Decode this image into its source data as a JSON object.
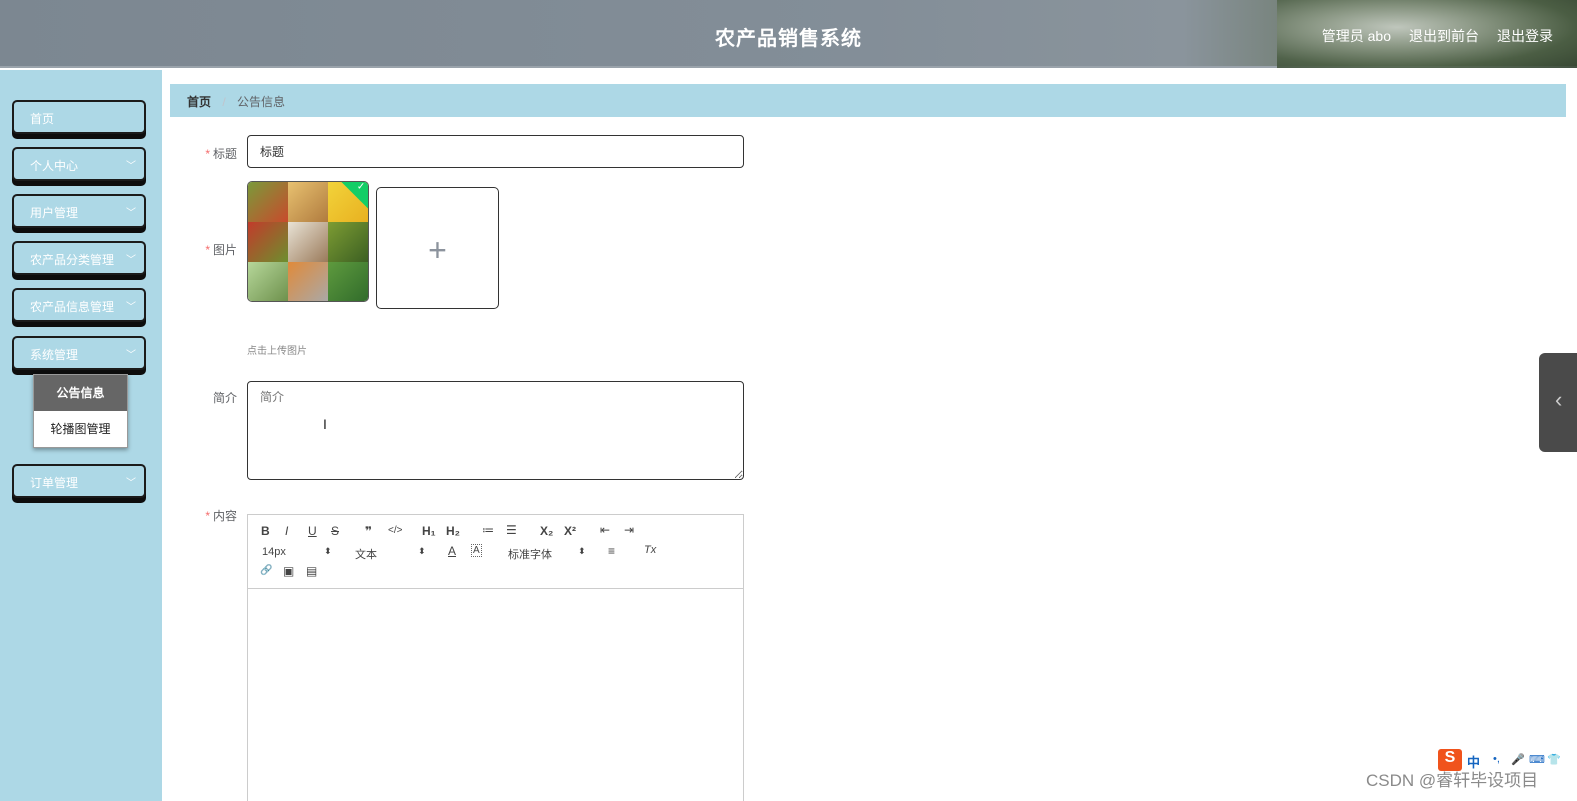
{
  "header": {
    "title": "农产品销售系统",
    "admin": "管理员 abo",
    "to_front": "退出到前台",
    "logout": "退出登录"
  },
  "sidebar": {
    "items": [
      {
        "label": "首页"
      },
      {
        "label": "个人中心"
      },
      {
        "label": "用户管理"
      },
      {
        "label": "农产品分类管理"
      },
      {
        "label": "农产品信息管理"
      },
      {
        "label": "系统管理"
      },
      {
        "label": "订单管理"
      }
    ],
    "submenu": [
      {
        "label": "公告信息",
        "active": true
      },
      {
        "label": "轮播图管理",
        "active": false
      }
    ]
  },
  "breadcrumb": {
    "home": "首页",
    "separator": "/",
    "current": "公告信息"
  },
  "form": {
    "required_mark": "*",
    "title_label": "标题",
    "title_value": "标题",
    "image_label": "图片",
    "upload_hint": "点击上传图片",
    "intro_label": "简介",
    "intro_placeholder": "简介",
    "content_label": "内容"
  },
  "editor": {
    "font_size": "14px",
    "text_type": "文本",
    "font_family": "标准字体",
    "buttons": {
      "bold": "B",
      "italic": "I",
      "underline": "U",
      "strike": "S",
      "quote": "❞",
      "code": "</>",
      "h1": "H₁",
      "h2": "H₂",
      "ordered_list": "≔",
      "bullet_list": "☰",
      "subscript": "X₂",
      "superscript": "X²",
      "outdent": "⇤",
      "indent": "⇥",
      "font_color": "A",
      "background": "A",
      "align": "≡",
      "clean": "Tx",
      "link": "🔗",
      "image": "▣",
      "video": "▤"
    }
  },
  "ime": {
    "logo": "S",
    "lang": "中"
  },
  "watermark": "CSDN @睿轩毕设项目",
  "colors": {
    "sidebar": "#add8e6",
    "breadcrumb": "#add8e6",
    "required": "#f56c6c",
    "active_submenu": "#666666"
  }
}
